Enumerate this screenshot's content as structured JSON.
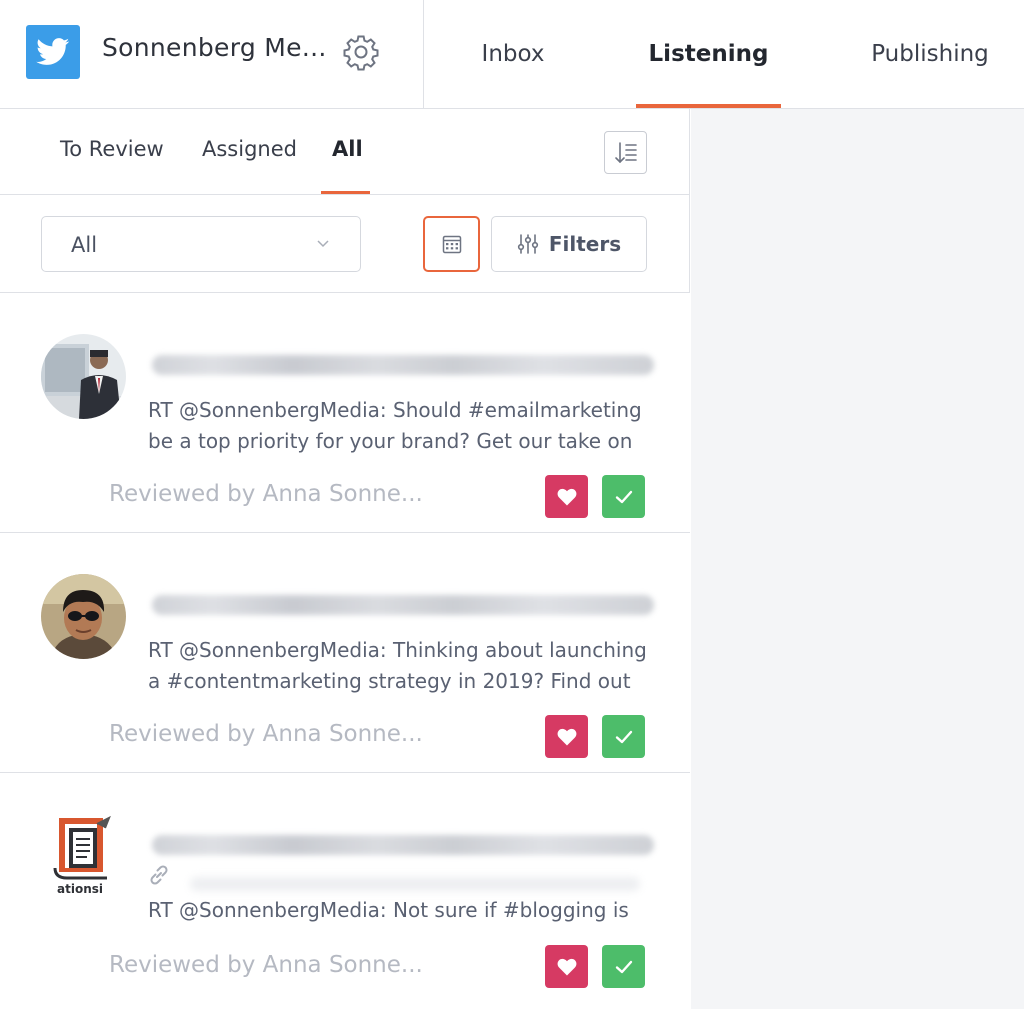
{
  "header": {
    "account_name": "Sonnenberg Me...",
    "nav_tabs": [
      {
        "label": "Inbox",
        "active": false
      },
      {
        "label": "Listening",
        "active": true
      },
      {
        "label": "Publishing",
        "active": false
      }
    ]
  },
  "subtabs": [
    {
      "label": "To Review",
      "active": false
    },
    {
      "label": "Assigned",
      "active": false
    },
    {
      "label": "All",
      "active": true
    }
  ],
  "filter": {
    "select_value": "All",
    "filters_label": "Filters"
  },
  "cards": [
    {
      "text_line1": "RT @SonnenbergMedia: Should #emailmarketing",
      "text_line2": "be a top priority for your brand? Get our take on",
      "reviewed": "Reviewed by Anna Sonne..."
    },
    {
      "text_line1": "RT @SonnenbergMedia: Thinking about launching",
      "text_line2": "a #contentmarketing strategy in 2019? Find out",
      "reviewed": "Reviewed by Anna Sonne..."
    },
    {
      "text_line1": "RT @SonnenbergMedia: Not sure if #blogging is",
      "reviewed": "Reviewed by Anna Sonne...",
      "logo_text": "ationsi"
    }
  ],
  "colors": {
    "accent": "#e9663c",
    "twitter": "#3b9de8",
    "like": "#d63a63",
    "approve": "#4dbd6a"
  },
  "icons": [
    "twitter-icon",
    "gear-icon",
    "sort-icon",
    "chevron-down-icon",
    "calendar-icon",
    "sliders-icon",
    "heart-icon",
    "check-icon",
    "link-icon"
  ]
}
